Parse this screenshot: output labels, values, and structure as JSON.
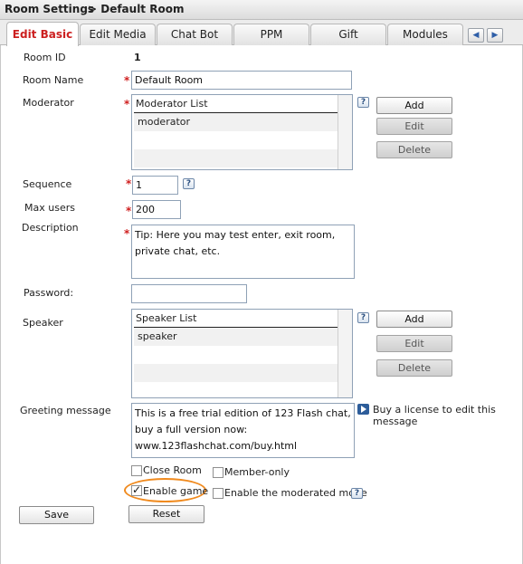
{
  "title": {
    "section": "Room Settings",
    "breadcrumb": "> Default Room"
  },
  "tabs": [
    {
      "label": "Edit Basic",
      "active": true
    },
    {
      "label": "Edit Media",
      "active": false
    },
    {
      "label": "Chat Bot",
      "active": false
    },
    {
      "label": "PPM",
      "active": false
    },
    {
      "label": "Gift",
      "active": false
    },
    {
      "label": "Modules",
      "active": false
    }
  ],
  "form": {
    "room_id_label": "Room ID",
    "room_id_value": "1",
    "room_name_label": "Room Name",
    "room_name_value": "Default Room",
    "moderator_label": "Moderator",
    "moderator_list_header": "Moderator List",
    "moderator_items": [
      "moderator"
    ],
    "sequence_label": "Sequence",
    "sequence_value": "1",
    "max_users_label": "Max users",
    "max_users_value": "200",
    "description_label": "Description",
    "description_value": "Tip: Here you may test enter, exit room, private chat, etc.",
    "password_label": "Password:",
    "password_value": "",
    "speaker_label": "Speaker",
    "speaker_list_header": "Speaker List",
    "speaker_items": [
      "speaker"
    ],
    "greeting_label": "Greeting message",
    "greeting_value": "This is a free trial edition of 123 Flash chat, buy a full version now: www.123flashchat.com/buy.html",
    "license_text": "Buy a license to edit this message"
  },
  "list_buttons": {
    "add": "Add",
    "edit": "Edit",
    "delete": "Delete"
  },
  "help_glyph": "?",
  "required_mark": "*",
  "checkboxes": {
    "close_room": {
      "label": "Close Room",
      "checked": false
    },
    "member_only": {
      "label": "Member-only",
      "checked": false
    },
    "enable_game": {
      "label": "Enable game",
      "checked": true
    },
    "moderated_mode": {
      "label": "Enable the moderated mode",
      "checked": false
    }
  },
  "actions": {
    "save": "Save",
    "reset": "Reset"
  },
  "colors": {
    "active_tab_text": "#cc1f1f",
    "required_star": "#d02020",
    "highlight_ring": "#f08a1e"
  }
}
